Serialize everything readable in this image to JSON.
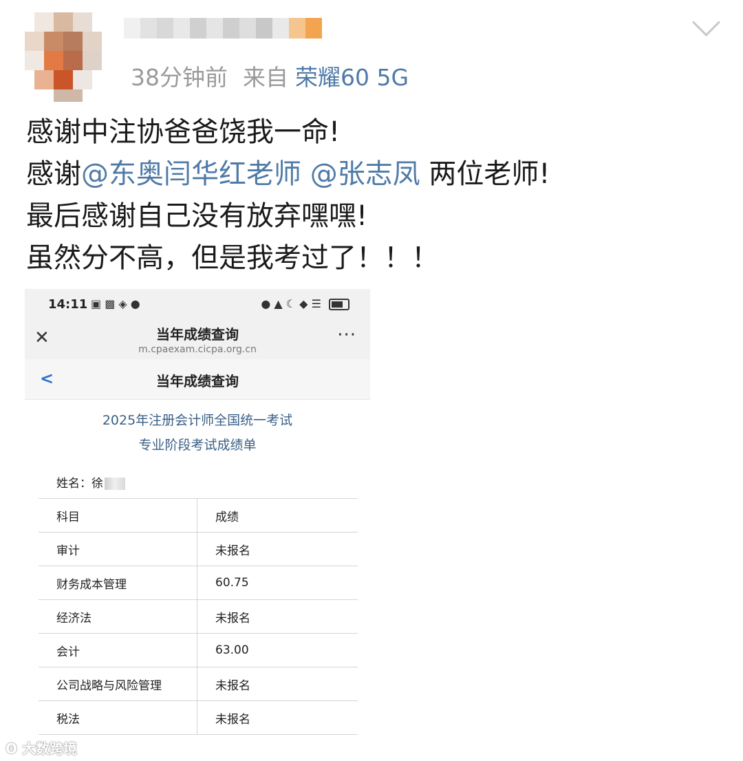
{
  "post_header": {
    "time_ago": "38分钟前",
    "source_prefix": "来自",
    "device": "荣耀60 5G"
  },
  "post_body": {
    "line1": "感谢中注协爸爸饶我一命!",
    "line2_prefix": "感谢",
    "mention1": "@东奥闫华红老师",
    "mention2": "@张志凤",
    "line2_suffix": " 两位老师!",
    "line3": "最后感谢自己没有放弃嘿嘿!",
    "line4": "虽然分不高，但是我考过了！！！"
  },
  "screenshot": {
    "status_bar": {
      "time": "14:11"
    },
    "browser_bar": {
      "title": "当年成绩查询",
      "url": "m.cpaexam.cicpa.org.cn"
    },
    "nav_bar": {
      "title": "当年成绩查询"
    },
    "heading_line1": "2025年注册会计师全国统一考试",
    "heading_line2": "专业阶段考试成绩单",
    "name_label": "姓名：",
    "name_value": "徐",
    "table_header": {
      "subject": "科目",
      "score": "成绩"
    },
    "rows": [
      {
        "subject": "审计",
        "score": "未报名"
      },
      {
        "subject": "财务成本管理",
        "score": "60.75"
      },
      {
        "subject": "经济法",
        "score": "未报名"
      },
      {
        "subject": "会计",
        "score": "63.00"
      },
      {
        "subject": "公司战略与风险管理",
        "score": "未报名"
      },
      {
        "subject": "税法",
        "score": "未报名"
      }
    ]
  },
  "watermark": "大数跨境",
  "colors": {
    "mention": "#4f7aa7",
    "meta_gray": "#9a9a9a",
    "heading_blue": "#3a5f86"
  }
}
